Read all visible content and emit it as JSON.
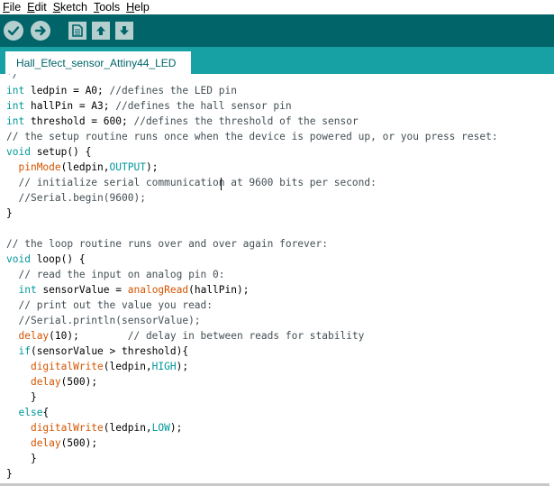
{
  "menu": {
    "items": [
      {
        "underline": "F",
        "rest": "ile"
      },
      {
        "underline": "E",
        "rest": "dit"
      },
      {
        "underline": "S",
        "rest": "ketch"
      },
      {
        "underline": "T",
        "rest": "ools"
      },
      {
        "underline": "H",
        "rest": "elp"
      }
    ]
  },
  "toolbar": {
    "buttons": [
      "verify-icon",
      "upload-icon",
      "new-icon",
      "open-icon",
      "save-icon"
    ]
  },
  "tabs": {
    "active": "Hall_Efect_sensor_Attiny44_LED"
  },
  "colors": {
    "toolbar": "#006468",
    "tabstrip": "#17a1a5",
    "keyword": "#00979c",
    "function": "#d35400",
    "comment": "#434f54"
  },
  "code": {
    "lines": [
      "*/",
      "int ledpin = A0; //defines the LED pin",
      "int hallPin = A3; //defines the hall sensor pin",
      "int threshold = 600; //defines the threshold of the sensor",
      "// the setup routine runs once when the device is powered up, or you press reset:",
      "void setup() {",
      "  pinMode(ledpin,OUTPUT);",
      "  // initialize serial communication at 9600 bits per second:",
      "  //Serial.begin(9600);",
      "}",
      "",
      "// the loop routine runs over and over again forever:",
      "void loop() {",
      "  // read the input on analog pin 0:",
      "  int sensorValue = analogRead(hallPin);",
      "  // print out the value you read:",
      "  //Serial.println(sensorValue);",
      "  delay(10);        // delay in between reads for stability",
      "  if(sensorValue > threshold){",
      "    digitalWrite(ledpin,HIGH);",
      "    delay(500);",
      "    }",
      "  else{",
      "    digitalWrite(ledpin,LOW);",
      "    delay(500);",
      "    }",
      "}"
    ]
  }
}
